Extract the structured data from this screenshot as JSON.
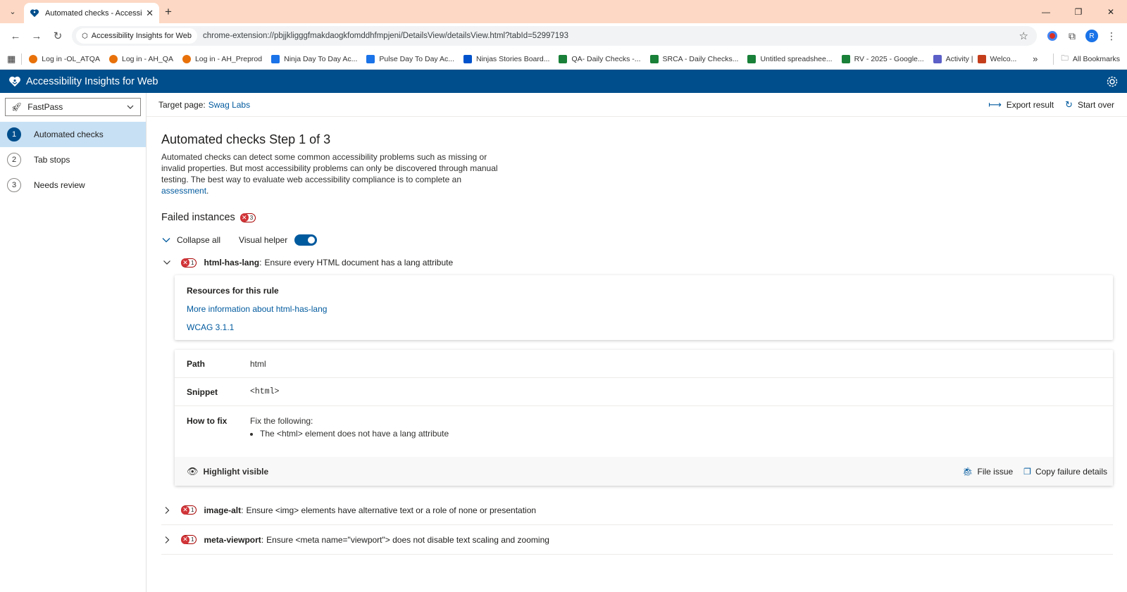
{
  "browser": {
    "tab_title": "Automated checks - Accessibility",
    "url_chip": "Accessibility Insights for Web",
    "url": "chrome-extension://pbjjkligggfmakdaogkfomddhfmpjeni/DetailsView/detailsView.html?tabId=52997193",
    "profile_initial": "R",
    "bookmarks": [
      {
        "label": "Log in -OL_ATQA",
        "icon": "gear-icon",
        "color": "#e8710a"
      },
      {
        "label": "Log in - AH_QA",
        "icon": "gear-icon",
        "color": "#e8710a"
      },
      {
        "label": "Log in - AH_Preprod",
        "icon": "gear-icon",
        "color": "#e8710a"
      },
      {
        "label": "Ninja Day To Day Ac...",
        "icon": "doc-icon",
        "color": "#1a73e8"
      },
      {
        "label": "Pulse Day To Day Ac...",
        "icon": "doc-icon",
        "color": "#1a73e8"
      },
      {
        "label": "Ninjas Stories Board...",
        "icon": "board-icon",
        "color": "#0052cc"
      },
      {
        "label": "QA- Daily Checks -...",
        "icon": "sheet-icon",
        "color": "#188038"
      },
      {
        "label": "SRCA - Daily Checks...",
        "icon": "sheet-icon",
        "color": "#188038"
      },
      {
        "label": "Untitled spreadshee...",
        "icon": "sheet-icon",
        "color": "#188038"
      },
      {
        "label": "RV - 2025 - Google...",
        "icon": "sheet-icon",
        "color": "#188038"
      },
      {
        "label": "Activity |",
        "icon": "teams-icon",
        "color": "#5b5fc7"
      },
      {
        "label": "Welco...",
        "icon": "teams-icon",
        "color": "#c43e1c"
      }
    ],
    "all_bookmarks": "All Bookmarks"
  },
  "app": {
    "name": "Accessibility Insights for Web"
  },
  "leftnav": {
    "mode": "FastPass",
    "items": [
      {
        "num": "1",
        "label": "Automated checks"
      },
      {
        "num": "2",
        "label": "Tab stops"
      },
      {
        "num": "3",
        "label": "Needs review"
      }
    ]
  },
  "cmdbar": {
    "target_label": "Target page:",
    "target_link": "Swag Labs",
    "export": "Export result",
    "start_over": "Start over"
  },
  "main": {
    "title": "Automated checks Step 1 of 3",
    "desc_prefix": "Automated checks can detect some common accessibility problems such as missing or invalid properties. But most accessibility problems can only be discovered through manual testing. The best way to evaluate web accessibility compliance is to complete an ",
    "desc_link": "assessment",
    "desc_suffix": ".",
    "failed_heading": "Failed instances",
    "failed_count": "3",
    "collapse_all": "Collapse all",
    "visual_helper": "Visual helper"
  },
  "rules": [
    {
      "id": "html-has-lang",
      "desc": "Ensure every HTML document has a lang attribute",
      "count": "1"
    },
    {
      "id": "image-alt",
      "desc": "Ensure <img> elements have alternative text or a role of none or presentation",
      "count": "1"
    },
    {
      "id": "meta-viewport",
      "desc": "Ensure <meta name=\"viewport\"> does not disable text scaling and zooming",
      "count": "1"
    }
  ],
  "resources": {
    "title": "Resources for this rule",
    "more_info": "More information about html-has-lang",
    "wcag": "WCAG 3.1.1"
  },
  "instance": {
    "path_label": "Path",
    "path_value": "html",
    "snippet_label": "Snippet",
    "snippet_value": "<html>",
    "fix_label": "How to fix",
    "fix_intro": "Fix the following:",
    "fix_item": "The <html> element does not have a lang attribute",
    "highlight": "Highlight visible",
    "file_issue": "File issue",
    "copy_details": "Copy failure details"
  }
}
